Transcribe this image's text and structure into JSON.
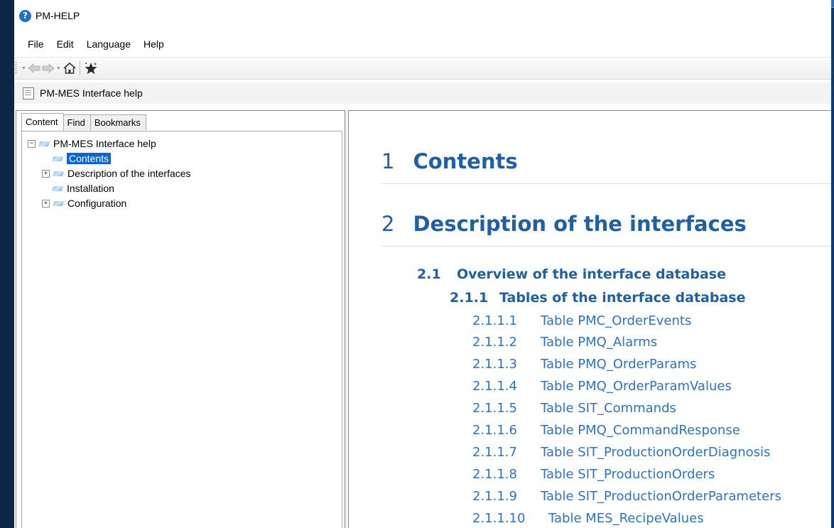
{
  "window": {
    "title": "PM-HELP"
  },
  "menu": [
    "File",
    "Edit",
    "Language",
    "Help"
  ],
  "docbar": {
    "title": "PM-MES Interface help"
  },
  "tabs": [
    "Content",
    "Find",
    "Bookmarks"
  ],
  "tree": [
    {
      "label": "PM-MES Interface help",
      "level": 0,
      "expander": "minus",
      "selected": false
    },
    {
      "label": "Contents",
      "level": 1,
      "expander": "none",
      "selected": true
    },
    {
      "label": "Description of the interfaces",
      "level": 1,
      "expander": "plus",
      "selected": false
    },
    {
      "label": "Installation",
      "level": 1,
      "expander": "none",
      "selected": false
    },
    {
      "label": "Configuration",
      "level": 1,
      "expander": "plus",
      "selected": false
    }
  ],
  "content": {
    "h1_1": {
      "num": "1",
      "title": "Contents"
    },
    "h1_2": {
      "num": "2",
      "title": "Description of the interfaces"
    },
    "h2_1": {
      "num": "2.1",
      "title": "Overview of the interface database"
    },
    "h3_1": {
      "num": "2.1.1",
      "title": "Tables of the interface database"
    },
    "items": [
      {
        "num": "2.1.1.1",
        "title": "Table PMC_OrderEvents"
      },
      {
        "num": "2.1.1.2",
        "title": "Table PMQ_Alarms"
      },
      {
        "num": "2.1.1.3",
        "title": "Table PMQ_OrderParams"
      },
      {
        "num": "2.1.1.4",
        "title": "Table PMQ_OrderParamValues"
      },
      {
        "num": "2.1.1.5",
        "title": "Table SIT_Commands"
      },
      {
        "num": "2.1.1.6",
        "title": "Table PMQ_CommandResponse"
      },
      {
        "num": "2.1.1.7",
        "title": "Table SIT_ProductionOrderDiagnosis"
      },
      {
        "num": "2.1.1.8",
        "title": "Table SIT_ProductionOrders"
      },
      {
        "num": "2.1.1.9",
        "title": "Table SIT_ProductionOrderParameters"
      },
      {
        "num": "2.1.1.10",
        "title": "Table MES_RecipeValues"
      }
    ]
  },
  "colors": {
    "heading": "#1f5fa8",
    "link": "#2c73c6",
    "selection": "#0a64d2"
  },
  "icons": [
    "help-icon",
    "back-arrow-icon",
    "forward-arrow-icon",
    "home-icon",
    "favorites-star-icon",
    "document-icon",
    "book-icon"
  ]
}
